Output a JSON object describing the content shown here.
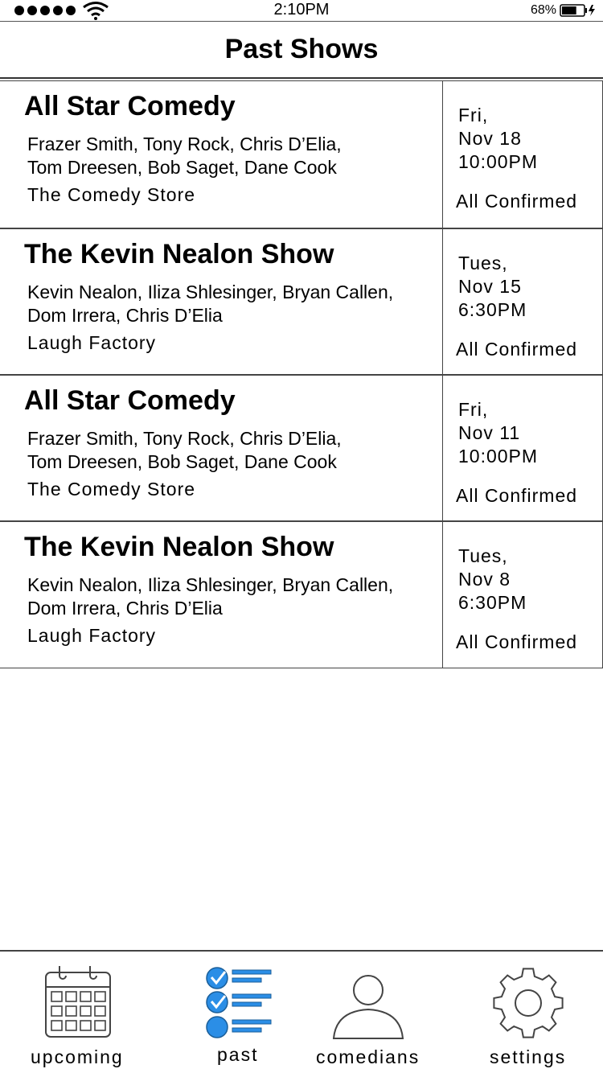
{
  "status_bar": {
    "time": "2:10PM",
    "battery_percent": "68%",
    "battery_level": 0.68,
    "signal_icon": "signal-dots-icon",
    "wifi_icon": "wifi-icon",
    "battery_icon": "battery-charging-icon"
  },
  "header": {
    "title": "Past Shows"
  },
  "shows": [
    {
      "title": "All Star Comedy",
      "lineup_line1": "Frazer Smith, Tony Rock, Chris D’Elia,",
      "lineup_line2": "Tom Dreesen, Bob Saget, Dane Cook",
      "venue": "The Comedy Store",
      "day": "Fri,",
      "date": "Nov 18",
      "time": "10:00PM",
      "status": "All Confirmed"
    },
    {
      "title": "The Kevin Nealon Show",
      "lineup_line1": "Kevin Nealon, Iliza Shlesinger, Bryan Callen,",
      "lineup_line2": "Dom Irrera, Chris D’Elia",
      "venue": "Laugh Factory",
      "day": "Tues,",
      "date": "Nov 15",
      "time": "6:30PM",
      "status": "All Confirmed"
    },
    {
      "title": "All Star Comedy",
      "lineup_line1": "Frazer Smith, Tony Rock, Chris D’Elia,",
      "lineup_line2": "Tom Dreesen, Bob Saget, Dane Cook",
      "venue": "The Comedy Store",
      "day": "Fri,",
      "date": "Nov 11",
      "time": "10:00PM",
      "status": "All Confirmed"
    },
    {
      "title": "The Kevin Nealon Show",
      "lineup_line1": "Kevin Nealon, Iliza Shlesinger, Bryan Callen,",
      "lineup_line2": "Dom Irrera, Chris D’Elia",
      "venue": "Laugh Factory",
      "day": "Tues,",
      "date": "Nov 8",
      "time": "6:30PM",
      "status": "All Confirmed"
    }
  ],
  "tabs": [
    {
      "label": "upcoming",
      "icon": "calendar-icon",
      "active": false
    },
    {
      "label": "past",
      "icon": "checklist-icon",
      "active": true
    },
    {
      "label": "comedians",
      "icon": "person-icon",
      "active": false
    },
    {
      "label": "settings",
      "icon": "gear-icon",
      "active": false
    }
  ],
  "colors": {
    "accent": "#2b8ee6",
    "text": "#000000",
    "border": "#444444"
  }
}
